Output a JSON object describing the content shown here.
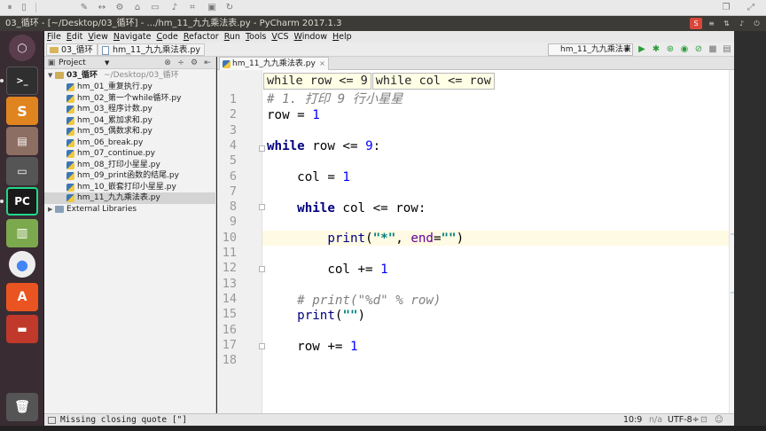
{
  "window_title": "03_循环 - [~/Desktop/03_循环] - .../hm_11_九九乘法表.py - PyCharm 2017.1.3",
  "menu": [
    "File",
    "Edit",
    "View",
    "Navigate",
    "Code",
    "Refactor",
    "Run",
    "Tools",
    "VCS",
    "Window",
    "Help"
  ],
  "breadcrumb": {
    "project": "03_循环",
    "file": "hm_11_九九乘法表.py"
  },
  "run_config": "hm_11_九九乘法表",
  "project_panel": {
    "header": "Project",
    "root": "03_循环",
    "root_path": "~/Desktop/03_循环",
    "files": [
      "hm_01_重复执行.py",
      "hm_02_第一个while循环.py",
      "hm_03_程序计数.py",
      "hm_04_累加求和.py",
      "hm_05_偶数求和.py",
      "hm_06_break.py",
      "hm_07_continue.py",
      "hm_08_打印小星星.py",
      "hm_09_print函数的结尾.py",
      "hm_10_嵌套打印小星星.py",
      "hm_11_九九乘法表.py"
    ],
    "selected_index": 10,
    "external": "External Libraries"
  },
  "editor": {
    "tab_label": "hm_11_九九乘法表.py",
    "breadcrumb_hints": [
      "while row <= 9",
      "while col <= row"
    ],
    "line_numbers": [
      "1",
      "2",
      "3",
      "4",
      "5",
      "6",
      "7",
      "8",
      "9",
      "10",
      "11",
      "12",
      "13",
      "14",
      "15",
      "16",
      "17",
      "18"
    ],
    "current_line": 10
  },
  "status": {
    "message": "Missing closing quote [\"]",
    "position": "10:9",
    "na": "n/a",
    "encoding": "UTF-8÷"
  },
  "colors": {
    "keyword": "#000080",
    "number": "#0000ff",
    "string": "#008080",
    "comment": "#808080",
    "current_line_bg": "#fffae3"
  }
}
